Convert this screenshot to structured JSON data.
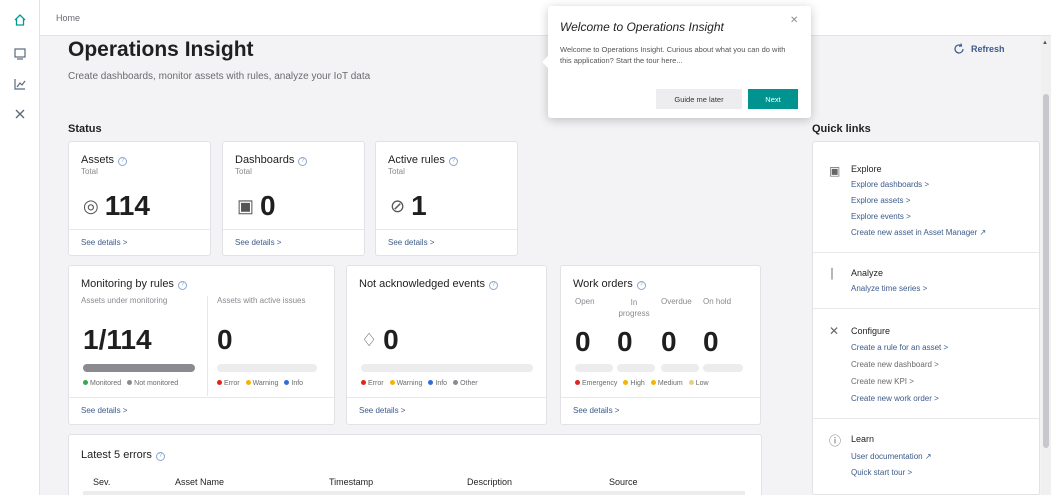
{
  "breadcrumb": "Home",
  "page": {
    "title": "Operations Insight",
    "subtitle": "Create dashboards, monitor assets with rules, analyze your IoT data",
    "refresh_label": "Refresh"
  },
  "status": {
    "label": "Status",
    "assets": {
      "title": "Assets",
      "sub": "Total",
      "value": "114",
      "link": "See details >"
    },
    "dashboards": {
      "title": "Dashboards",
      "sub": "Total",
      "value": "0",
      "link": "See details >"
    },
    "rules": {
      "title": "Active rules",
      "sub": "Total",
      "value": "1",
      "link": "See details >"
    }
  },
  "monitoring": {
    "title": "Monitoring by rules",
    "left_head": "Assets under monitoring",
    "right_head": "Assets with active issues",
    "left_value": "1/114",
    "right_value": "0",
    "legend_left": [
      "Monitored",
      "Not monitored"
    ],
    "legend_right": [
      "Error",
      "Warning",
      "Info"
    ],
    "link": "See details >"
  },
  "events": {
    "title": "Not acknowledged events",
    "value": "0",
    "legend": [
      "Error",
      "Warning",
      "Info",
      "Other"
    ],
    "link": "See details >"
  },
  "work_orders": {
    "title": "Work orders",
    "columns": [
      "Open",
      "In progress",
      "Overdue",
      "On hold"
    ],
    "values": [
      "0",
      "0",
      "0",
      "0"
    ],
    "legend": [
      "Emergency",
      "High",
      "Medium",
      "Low"
    ],
    "link": "See details >"
  },
  "errors": {
    "title": "Latest 5 errors",
    "columns": [
      "Sev.",
      "Asset Name",
      "Timestamp",
      "Description",
      "Source"
    ]
  },
  "quick_links": {
    "label": "Quick links",
    "explore": {
      "title": "Explore",
      "links": [
        "Explore dashboards >",
        "Explore assets >",
        "Explore events >",
        "Create new asset in Asset Manager ↗"
      ]
    },
    "analyze": {
      "title": "Analyze",
      "links": [
        "Analyze time series >"
      ]
    },
    "configure": {
      "title": "Configure",
      "links": [
        "Create a rule for an asset >",
        "Create new dashboard >",
        "Create new KPI >",
        "Create new work order >"
      ]
    },
    "learn": {
      "title": "Learn",
      "links": [
        "User documentation ↗",
        "Quick start tour >"
      ]
    }
  },
  "popover": {
    "title": "Welcome to Operations Insight",
    "body": "Welcome to Operations Insight. Curious about what you can do with this application? Start the tour here...",
    "later_label": "Guide me later",
    "next_label": "Next"
  },
  "colors": {
    "accent": "#009999",
    "link": "#3c5b8a",
    "error": "#e0251b",
    "warning": "#f5b400",
    "info": "#2f6fd6",
    "monitored": "#3aa655",
    "not_monitored": "#8a8a90",
    "medium": "#f5b400",
    "low": "#e9cf80",
    "monitoring_fill_fraction": 0.01
  },
  "icons": {
    "rail": [
      "home-icon",
      "dashboard-icon",
      "chart-icon",
      "tools-icon"
    ]
  }
}
